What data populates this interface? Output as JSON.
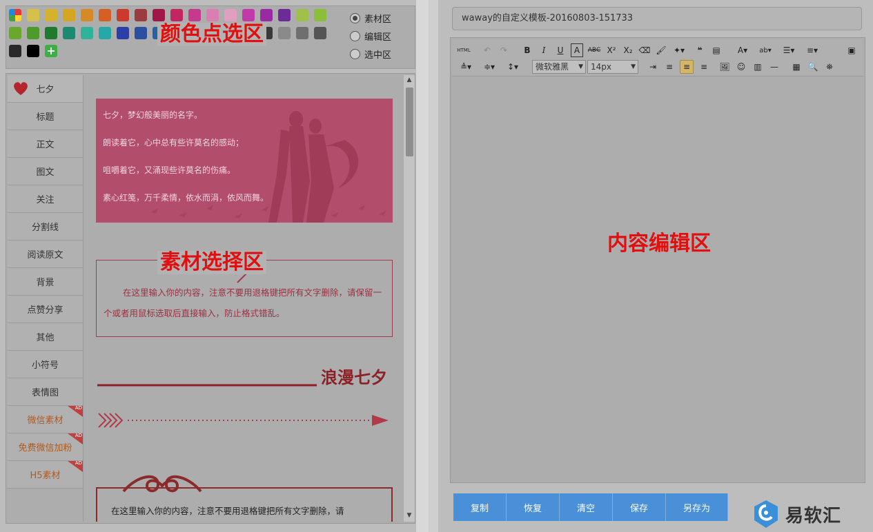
{
  "palette": {
    "label": "颜色点选区",
    "rows": [
      [
        "#2b6fd6",
        "#d6c04c",
        "#d4b32a",
        "#d4a621",
        "#d68a26",
        "#d56024",
        "#c93b2a",
        "#9b3a3f",
        "#a0154a",
        "#c22563",
        "#c53a8c",
        "#d97fb2",
        "#e09ec0",
        "#c23aa9",
        "#9a2aa3",
        "#6c2b97",
        "#a0c04a",
        "#8bbf3a"
      ],
      [
        "#6aa82a",
        "#4e9a2a",
        "#1f7a2f",
        "#1c8a70",
        "#2fb39a",
        "#26a7a8",
        "#2e3ea8",
        "#2d4fa0",
        "#2a60a8",
        "#3b3b8f",
        "#666666",
        "#7a7a7a",
        "#8a8a8a",
        "#6a6a6a",
        "#3a3a3a",
        "#8a8a8a",
        "#6f6f6f",
        "#555555"
      ],
      [
        "#2a2a2a",
        "#000000"
      ]
    ],
    "add_symbol": "+",
    "modes": [
      {
        "label": "素材区",
        "checked": true
      },
      {
        "label": "编辑区",
        "checked": false
      },
      {
        "label": "选中区",
        "checked": false
      }
    ]
  },
  "material": {
    "label": "素材选择区",
    "categories": [
      {
        "label": "七夕",
        "promo": false
      },
      {
        "label": "标题",
        "promo": false
      },
      {
        "label": "正文",
        "promo": false
      },
      {
        "label": "图文",
        "promo": false
      },
      {
        "label": "关注",
        "promo": false
      },
      {
        "label": "分割线",
        "promo": false
      },
      {
        "label": "阅读原文",
        "promo": false
      },
      {
        "label": "背景",
        "promo": false
      },
      {
        "label": "点赞分享",
        "promo": false
      },
      {
        "label": "其他",
        "promo": false
      },
      {
        "label": "小符号",
        "promo": false
      },
      {
        "label": "表情图",
        "promo": false
      },
      {
        "label": "微信素材",
        "promo": true,
        "badge": "AD"
      },
      {
        "label": "免费微信加粉",
        "promo": true,
        "badge": "AD"
      },
      {
        "label": "H5素材",
        "promo": true,
        "badge": "AD"
      }
    ],
    "qixi_lines": [
      "七夕，梦幻般美丽的名字。",
      "朗读着它，心中总有些许莫名的感动；",
      "咀嚼着它，又涌现些许莫名的伤痛。",
      "素心红笺，万千柔情，依水而涓，依风而舞。"
    ],
    "frame_text": "在这里输入你的内容，注意不要用退格键把所有文字删除，请保留一个或者用鼠标选取后直接输入，防止格式错乱。",
    "romance_title": "浪漫七夕",
    "ribbon_text": "在这里输入你的内容，注意不要用退格键把所有文字删除，请"
  },
  "editor": {
    "title_value": "waway的自定义模板-20160803-151733",
    "font_family": "微软雅黑",
    "font_size": "14px",
    "html_label": "HTML",
    "body_label": "内容编辑区"
  },
  "actions": [
    "复制",
    "恢复",
    "清空",
    "保存",
    "另存为"
  ],
  "logo": {
    "name": "易软汇"
  }
}
